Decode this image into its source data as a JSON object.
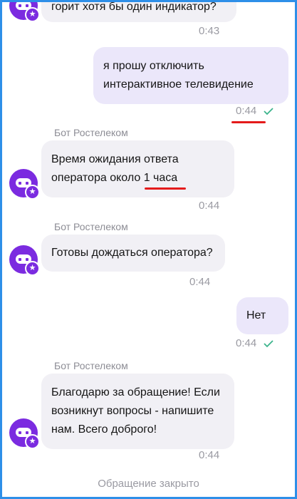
{
  "messages": {
    "m1": {
      "text": "горит хотя бы один индикатор?",
      "time": "0:43"
    },
    "m2": {
      "line1": "я прошу отключить",
      "line2": "интерактивное телевидение",
      "time": "0:44"
    },
    "m3": {
      "sender": "Бот Ростелеком",
      "line1": "Время ожидания ответа",
      "line2_pre": "оператора около ",
      "line2_hl": "1 часа",
      "time": "0:44"
    },
    "m4": {
      "sender": "Бот Ростелеком",
      "text": "Готовы дождаться оператора?",
      "time": "0:44"
    },
    "m5": {
      "text": "Нет",
      "time": "0:44"
    },
    "m6": {
      "sender": "Бот Ростелеком",
      "line1": "Благодарю за обращение! Если",
      "line2": "возникнут вопросы - напишите",
      "line3": "нам. Всего доброго!",
      "time": "0:44"
    }
  },
  "footer": {
    "status": "Обращение закрыто"
  },
  "colors": {
    "accent": "#7b2be0",
    "outgoing_bubble": "#ebe7fa",
    "incoming_bubble": "#f1f0f5",
    "read_check": "#3cb48c",
    "annotation_red": "#e41b1b",
    "frame_border": "#2e8fe8"
  },
  "icons": {
    "avatar": "rostelecom-bot-icon",
    "read": "double-check-icon"
  }
}
